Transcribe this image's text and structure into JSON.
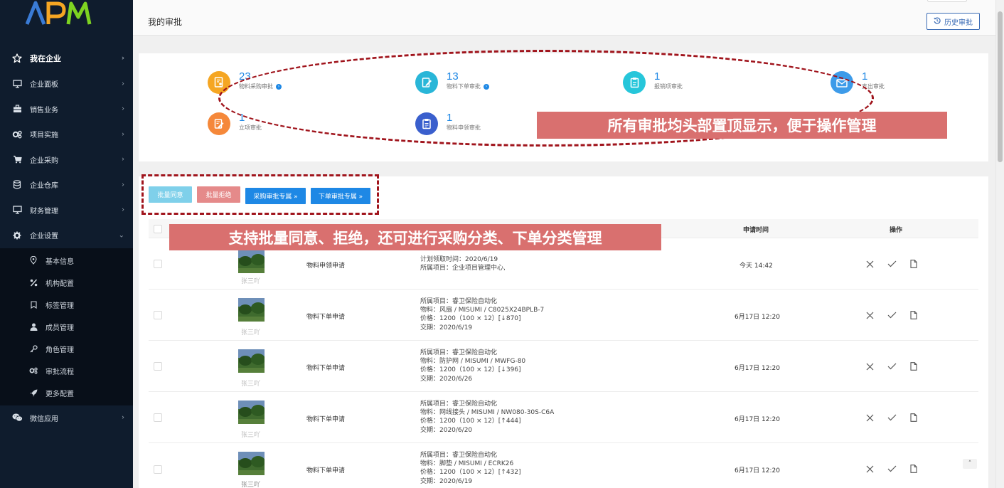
{
  "logo": {
    "text": "APM"
  },
  "sidebar": {
    "items": [
      {
        "label": "我在企业",
        "icon": "star-icon"
      },
      {
        "label": "企业面板",
        "icon": "monitor-icon"
      },
      {
        "label": "销售业务",
        "icon": "briefcase-icon"
      },
      {
        "label": "项目实施",
        "icon": "gears-icon"
      },
      {
        "label": "企业采购",
        "icon": "cart-icon"
      },
      {
        "label": "企业仓库",
        "icon": "database-icon"
      },
      {
        "label": "财务管理",
        "icon": "monitor-icon"
      },
      {
        "label": "企业设置",
        "icon": "gear-icon"
      }
    ],
    "sub_items": [
      {
        "label": "基本信息",
        "icon": "location-pin-icon"
      },
      {
        "label": "机构配置",
        "icon": "percent-icon"
      },
      {
        "label": "标签管理",
        "icon": "bookmark-icon"
      },
      {
        "label": "成员管理",
        "icon": "user-icon"
      },
      {
        "label": "角色管理",
        "icon": "key-icon"
      },
      {
        "label": "审批流程",
        "icon": "gears-icon"
      },
      {
        "label": "更多配置",
        "icon": "rocket-icon"
      }
    ],
    "last_item": {
      "label": "微信应用",
      "icon": "wechat-icon"
    }
  },
  "header": {
    "title": "我的审批",
    "history_button": "历史审批"
  },
  "summary": [
    {
      "count": "23",
      "label": "物料采购审批",
      "color": "#f5a623",
      "icon": "document-user-icon",
      "has_info": true
    },
    {
      "count": "13",
      "label": "物料下单审批",
      "color": "#29b6d8",
      "icon": "document-edit-icon",
      "has_info": true
    },
    {
      "count": "1",
      "label": "报销项审批",
      "color": "#26c6da",
      "icon": "clipboard-icon",
      "has_info": false
    },
    {
      "count": "1",
      "label": "支出审批",
      "color": "#3d9be9",
      "icon": "envelope-icon",
      "has_info": false
    },
    {
      "count": "1",
      "label": "立项审批",
      "color": "#f5883a",
      "icon": "document-pen-icon",
      "has_info": false
    },
    {
      "count": "1",
      "label": "物料申领审批",
      "color": "#3a5fcd",
      "icon": "clipboard-list-icon",
      "has_info": false
    }
  ],
  "actions": {
    "batch_approve": "批量同意",
    "batch_reject": "批量拒绝",
    "purchase_zone": "采购审批专属 »",
    "order_zone": "下单审批专属 »"
  },
  "table": {
    "columns": {
      "time": "申请时间",
      "ops": "操作"
    },
    "rows": [
      {
        "user": "张三吖",
        "type": "物料申领申请",
        "details": [
          "计划领取时间：2020/6/19",
          "所属项目：企业项目管理中心,"
        ],
        "time": "今天 14:42"
      },
      {
        "user": "张三吖",
        "type": "物料下单申请",
        "details": [
          "所属项目：睿卫保险自动化",
          "物料：风扇 / MISUMI / C8025X24BPLB-7",
          "价格：1200（100 × 12）[↓870]",
          "交期：2020/6/19"
        ],
        "time": "6月17日 12:20"
      },
      {
        "user": "张三吖",
        "type": "物料下单申请",
        "details": [
          "所属项目：睿卫保险自动化",
          "物料：防护网 / MISUMI / MWFG-80",
          "价格：1200（100 × 12）[↓396]",
          "交期：2020/6/26"
        ],
        "time": "6月17日 12:20"
      },
      {
        "user": "张三吖",
        "type": "物料下单申请",
        "details": [
          "所属项目：睿卫保险自动化",
          "物料：网线接头 / MISUMI / NW080-30S-C6A",
          "价格：1200（100 × 12）[↑444]",
          "交期：2020/6/20"
        ],
        "time": "6月17日 12:20"
      },
      {
        "user": "张三吖",
        "type": "物料下单申请",
        "details": [
          "所属项目：睿卫保险自动化",
          "物料：脚垫 / MISUMI / ECRK26",
          "价格：1200（100 × 12）[↑432]",
          "交期：2020/6/19"
        ],
        "time": "6月17日 12:20"
      }
    ]
  },
  "annotations": {
    "top_note": "所有审批均头部置顶显示，便于操作管理",
    "batch_note": "支持批量同意、拒绝，还可进行采购分类、下单分类管理"
  },
  "colors": {
    "sidebar_bg": "#0f1c2d",
    "accent_blue": "#1e88e5",
    "annotation_red": "#a0141c",
    "callout_bg": "#d9706f"
  }
}
